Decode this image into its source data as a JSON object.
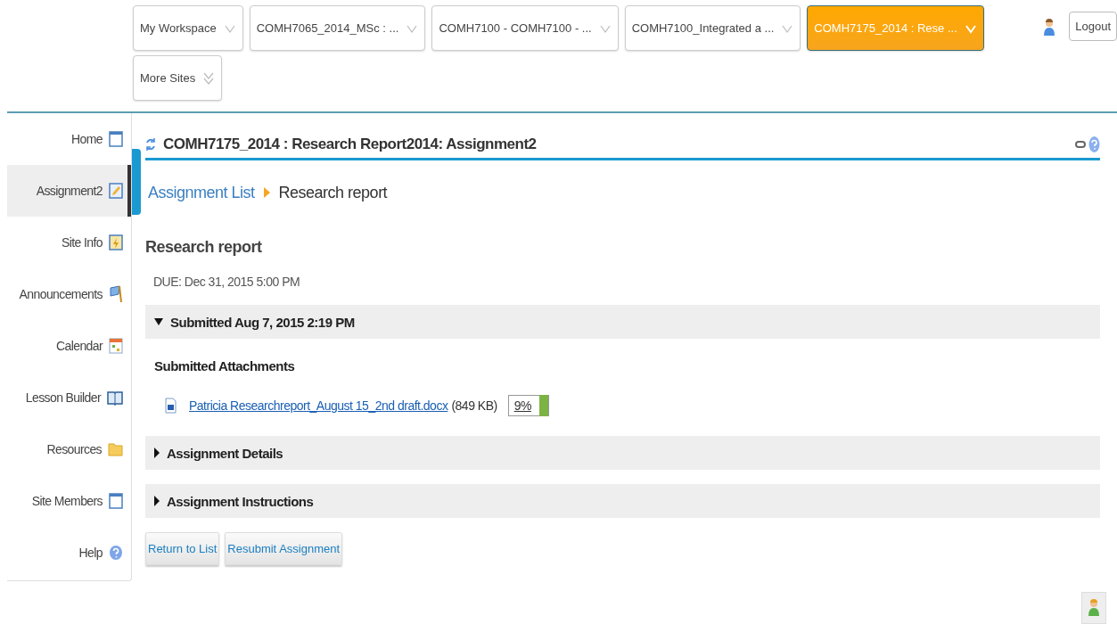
{
  "sites": [
    {
      "label": "My Workspace",
      "selected": false
    },
    {
      "label": "COMH7065_2014_MSc : ...",
      "selected": false
    },
    {
      "label": "COMH7100 - COMH7100 - ...",
      "selected": false
    },
    {
      "label": "COMH7100_Integrated a ...",
      "selected": false
    },
    {
      "label": "COMH7175_2014 : Rese ...",
      "selected": true
    }
  ],
  "more_sites": "More Sites",
  "logout": "Logout",
  "tool_menu": [
    {
      "label": "Home",
      "kind": "page",
      "selected": false
    },
    {
      "label": "Assignment2",
      "kind": "assignment",
      "selected": true
    },
    {
      "label": "Site Info",
      "kind": "siteinfo",
      "selected": false
    },
    {
      "label": "Announcements",
      "kind": "announce",
      "selected": false
    },
    {
      "label": "Calendar",
      "kind": "calendar",
      "selected": false
    },
    {
      "label": "Lesson Builder",
      "kind": "book",
      "selected": false
    },
    {
      "label": "Resources",
      "kind": "folder",
      "selected": false
    },
    {
      "label": "Site Members",
      "kind": "page",
      "selected": false
    },
    {
      "label": "Help",
      "kind": "help",
      "selected": false
    }
  ],
  "tool_title": "COMH7175_2014 : Research Report2014: Assignment2",
  "breadcrumb": {
    "link": "Assignment List",
    "current": "Research report"
  },
  "heading": "Research report",
  "due": "DUE: Dec 31, 2015 5:00 PM",
  "sections": [
    {
      "title": "Submitted Aug 7, 2015 2:19 PM",
      "expanded": true,
      "subheading": "Submitted Attachments",
      "attachments": [
        {
          "name": "Patricia Researchreport_August 15_2nd draft.docx",
          "size": "(849 KB)",
          "score": "9%",
          "color": "#7cb342"
        }
      ]
    },
    {
      "title": "Assignment Details",
      "expanded": false
    },
    {
      "title": "Assignment Instructions",
      "expanded": false
    }
  ],
  "buttons": [
    "Return to List",
    "Resubmit Assignment"
  ]
}
